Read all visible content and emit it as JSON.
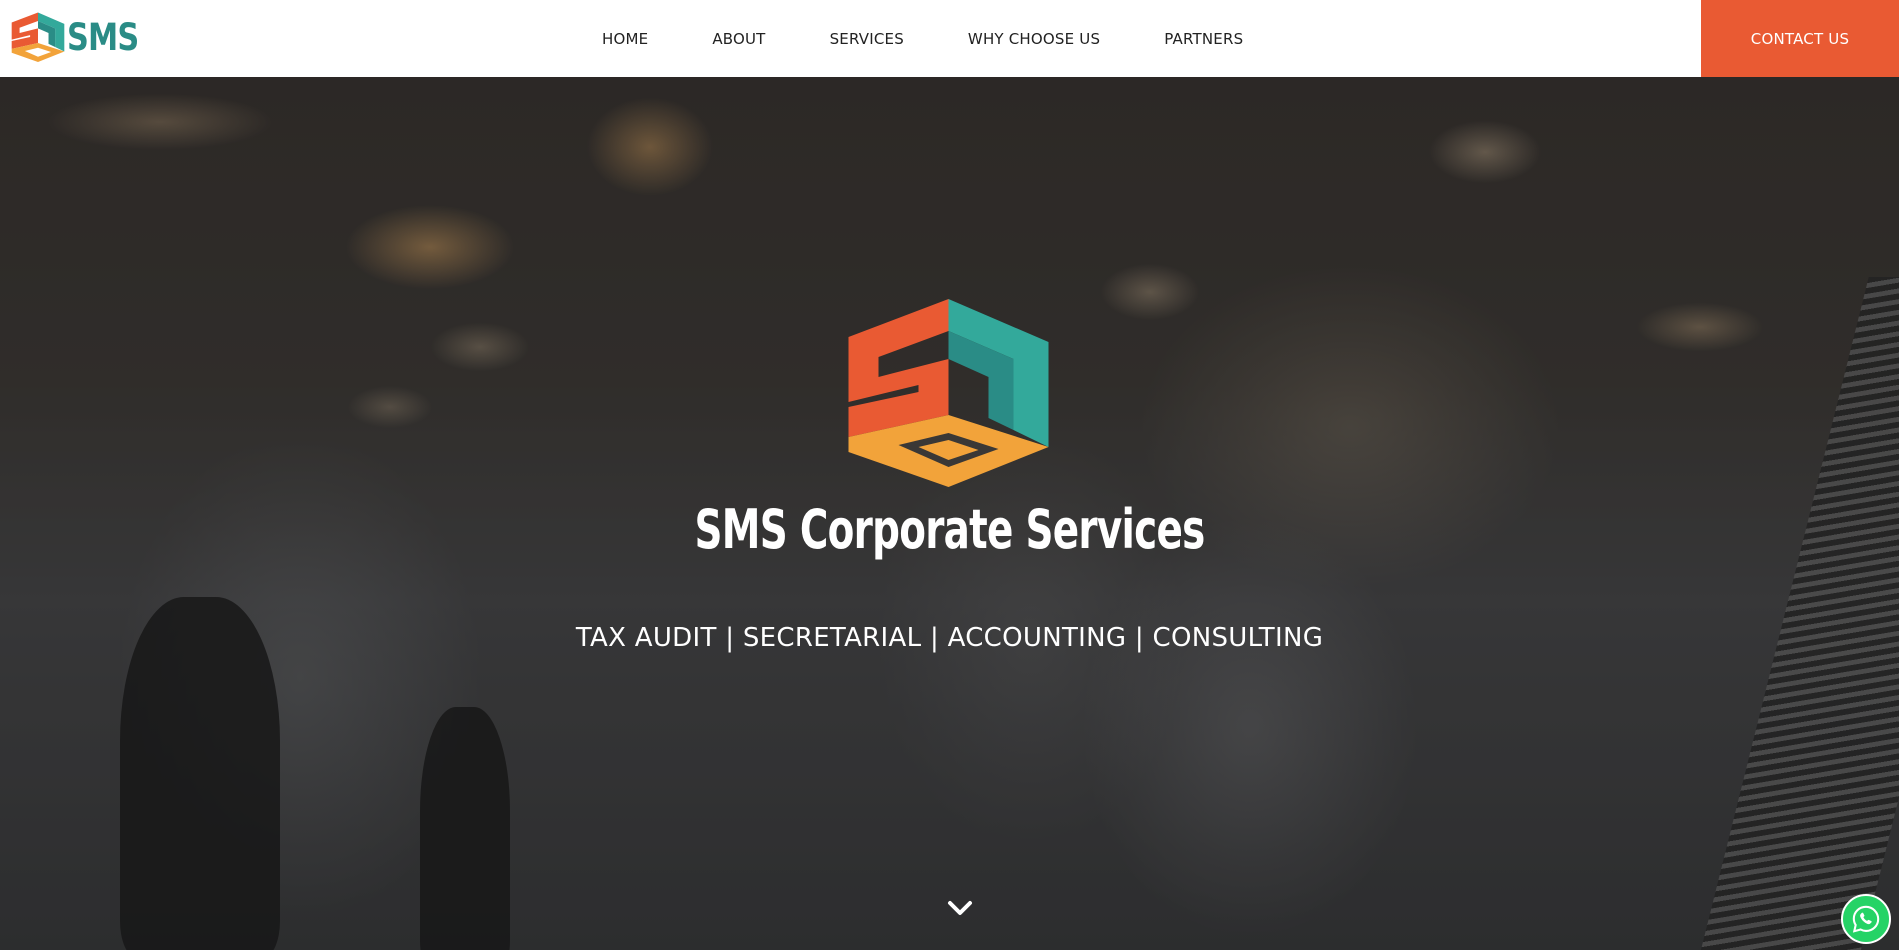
{
  "header": {
    "brand_text": "SMS",
    "nav_items": [
      {
        "label": "HOME"
      },
      {
        "label": "ABOUT"
      },
      {
        "label": "SERVICES"
      },
      {
        "label": "WHY CHOOSE US"
      },
      {
        "label": "PARTNERS"
      }
    ],
    "contact_label": "CONTACT US"
  },
  "hero": {
    "title": "SMS Corporate Services",
    "tagline": "TAX AUDIT | SECRETARIAL | ACCOUNTING | CONSULTING",
    "scroll_icon": "chevron-down-icon"
  },
  "floating": {
    "whatsapp_icon": "whatsapp-icon"
  },
  "colors": {
    "accent": "#e95a33",
    "brand_teal": "#2a8c86",
    "logo_orange_red": "#e95a33",
    "logo_teal": "#33a99b",
    "logo_amber": "#f2a33a",
    "whatsapp_green": "#25d366"
  }
}
